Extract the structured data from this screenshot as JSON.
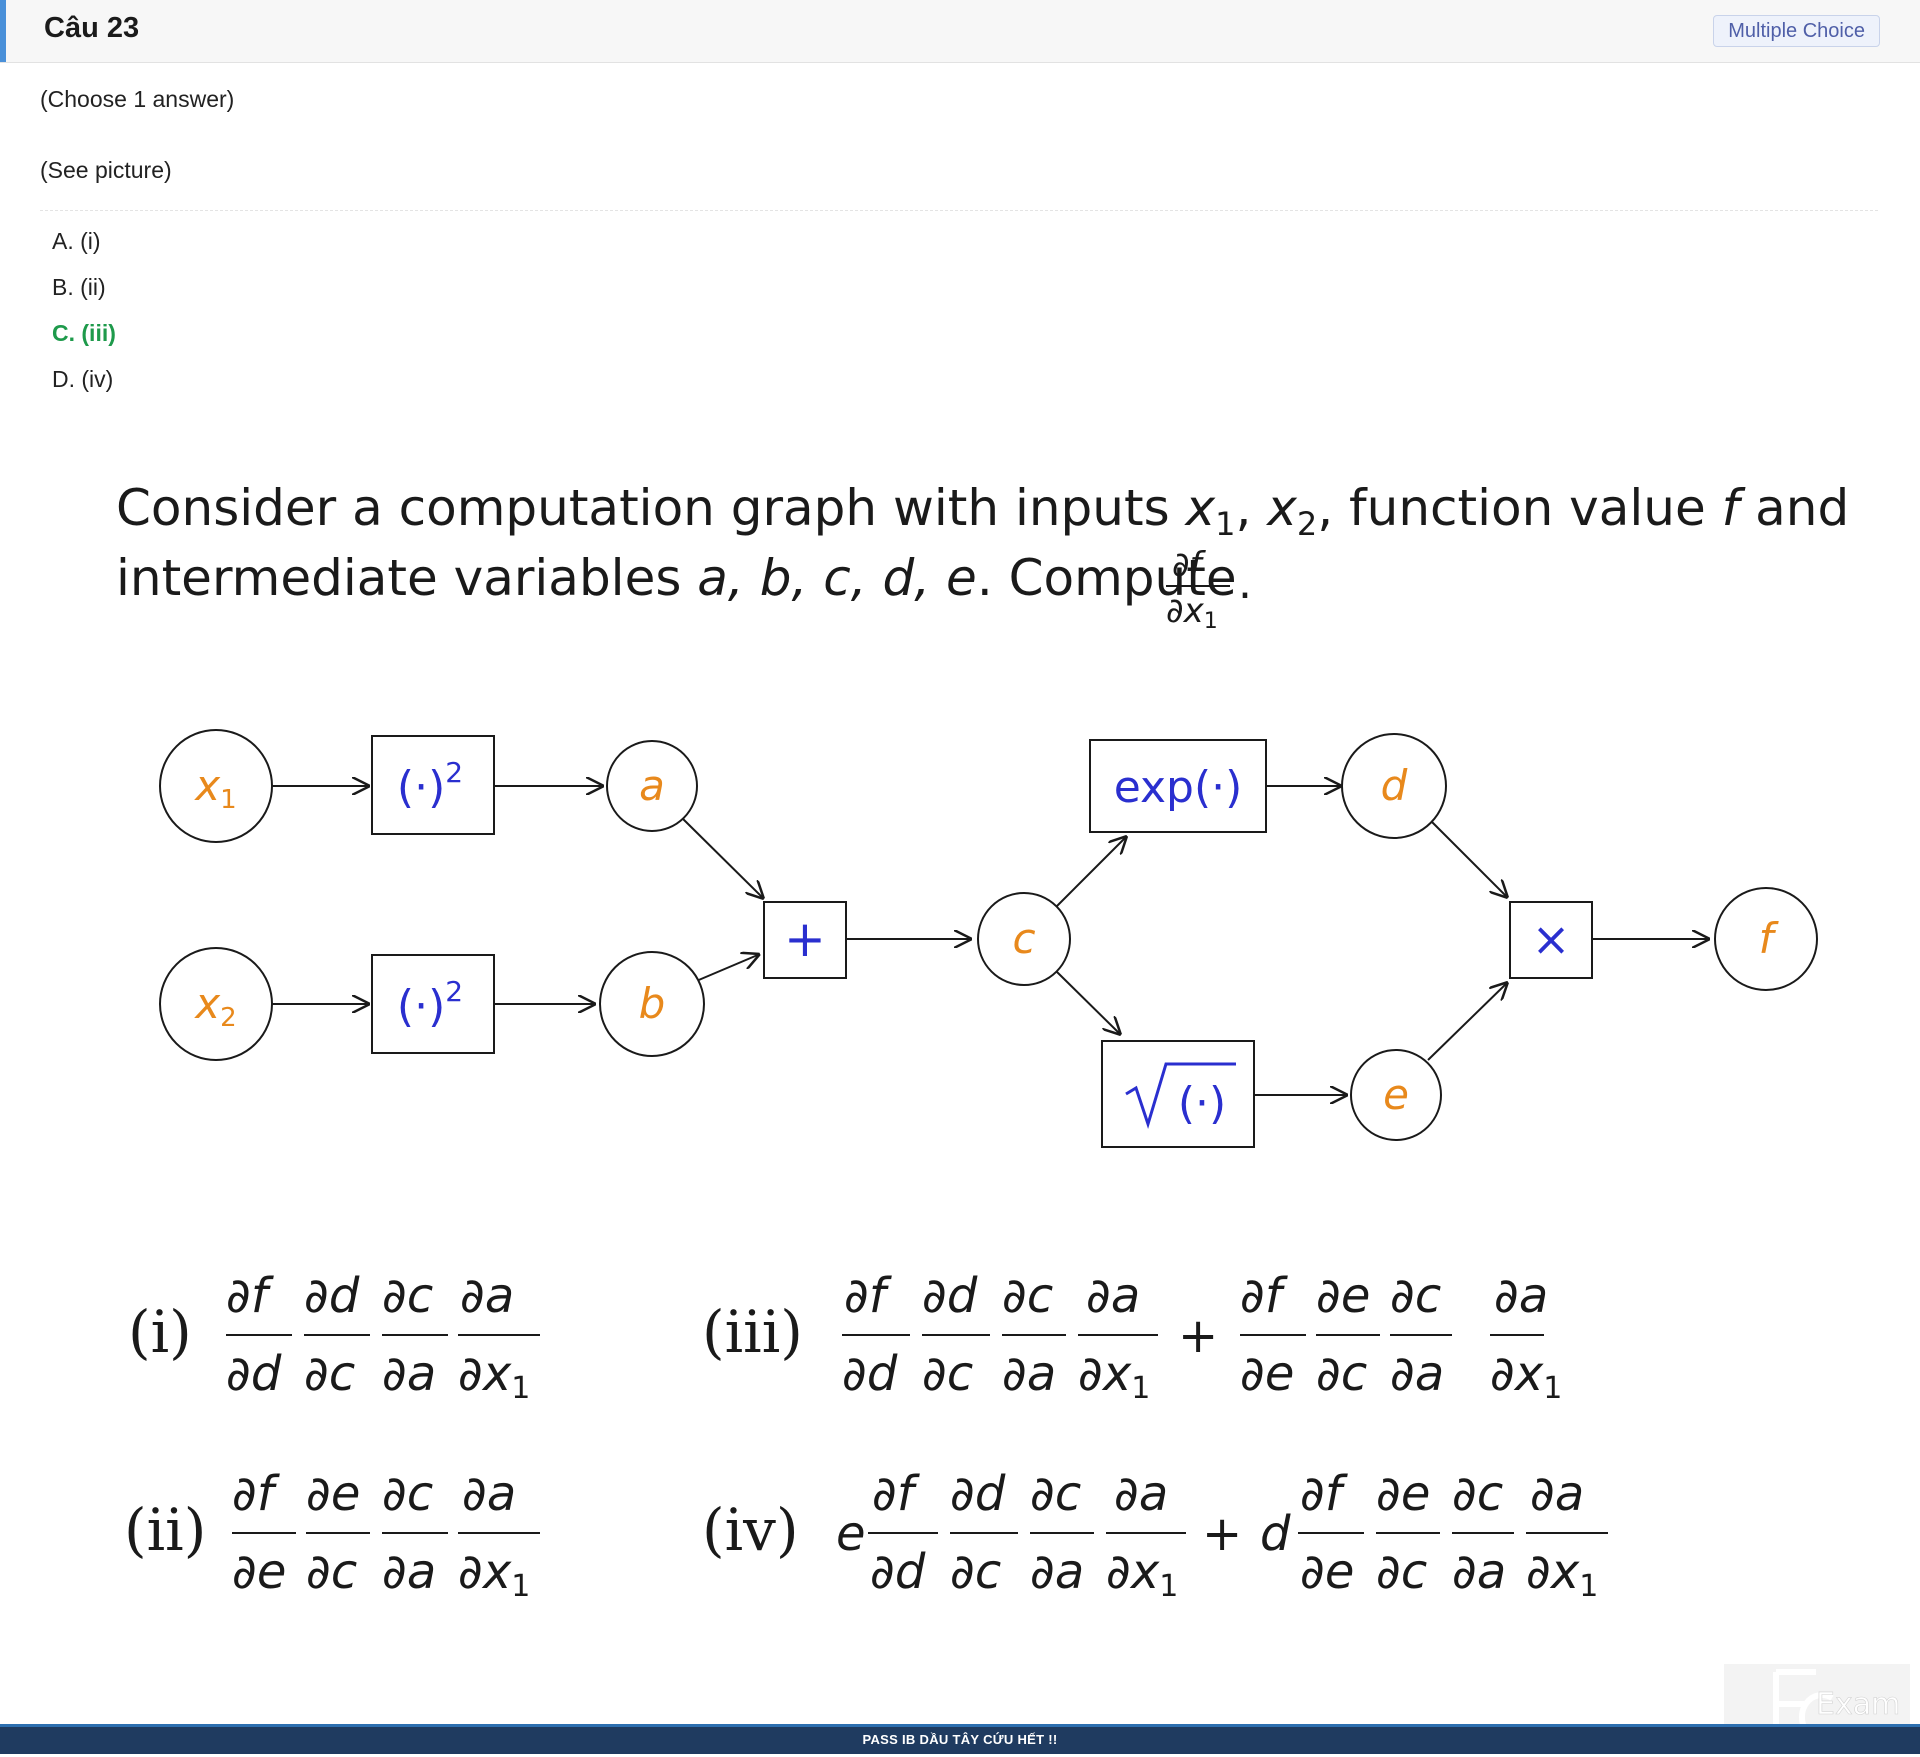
{
  "header": {
    "question_title": "Câu 23",
    "question_type": "Multiple Choice"
  },
  "question": {
    "instruction": "(Choose 1 answer)",
    "prompt": "(See picture)"
  },
  "options": [
    {
      "label": "A. (i)",
      "correct": false
    },
    {
      "label": "B. (ii)",
      "correct": false
    },
    {
      "label": "C. (iii)",
      "correct": true
    },
    {
      "label": "D. (iv)",
      "correct": false
    }
  ],
  "figure": {
    "line1_prefix": "Consider a computation graph with inputs ",
    "line1_mid": ", function value ",
    "line1_suffix": " and",
    "line2_prefix": "intermediate variables ",
    "line2_mid": ". Compute ",
    "nodes": {
      "x1": "x",
      "x2": "x",
      "a": "a",
      "b": "b",
      "c": "c",
      "d": "d",
      "e": "e",
      "f": "f",
      "square_1": "(·)",
      "square_2": "(·)",
      "plus": "+",
      "exp": "exp(·)",
      "sqrt": "(·)",
      "times": "×"
    },
    "answer_labels": [
      "(i)",
      "(ii)",
      "(iii)",
      "(iv)"
    ],
    "colors": {
      "node_var": "#e8891c",
      "op_text": "#2a2fcf",
      "stroke": "#1a1a1a"
    }
  },
  "footer": {
    "text": "PASS IB DẦU TÂY CỨU HẾT !!",
    "logo_text": "Exam"
  }
}
